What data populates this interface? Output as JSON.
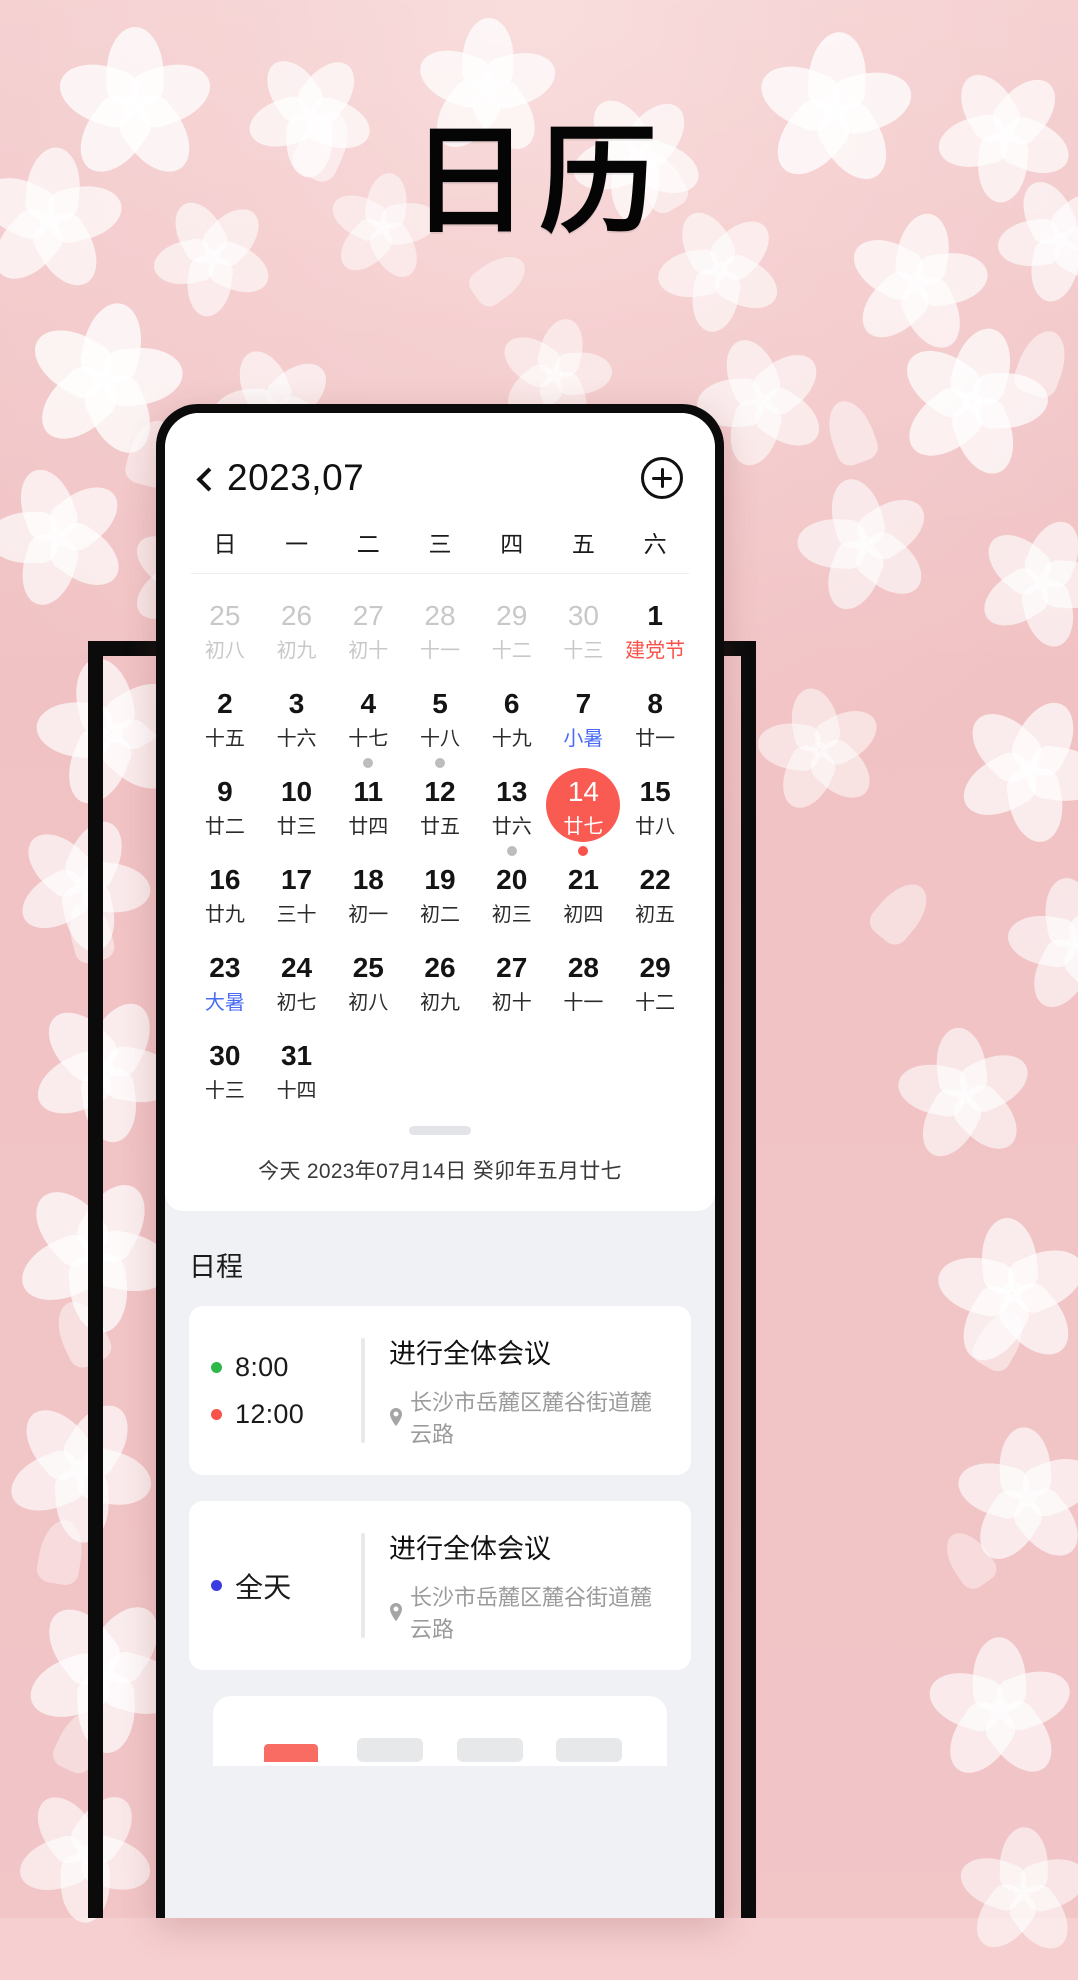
{
  "page": {
    "title": "日历",
    "background_color": "#f3c8ca",
    "accent_color": "#F8534A"
  },
  "calendar": {
    "back_icon": "chevron-left-icon",
    "year_month": "2023,07",
    "add_icon": "plus-circle-icon",
    "weekdays": [
      "日",
      "一",
      "二",
      "三",
      "四",
      "五",
      "六"
    ],
    "today_line": "今天 2023年07月14日  癸卯年五月廿七",
    "weeks": [
      [
        {
          "num": "25",
          "lunar": "初八",
          "out": true
        },
        {
          "num": "26",
          "lunar": "初九",
          "out": true
        },
        {
          "num": "27",
          "lunar": "初十",
          "out": true
        },
        {
          "num": "28",
          "lunar": "十一",
          "out": true
        },
        {
          "num": "29",
          "lunar": "十二",
          "out": true
        },
        {
          "num": "30",
          "lunar": "十三",
          "out": true
        },
        {
          "num": "1",
          "lunar": "建党节",
          "lunar_color": "red"
        }
      ],
      [
        {
          "num": "2",
          "lunar": "十五"
        },
        {
          "num": "3",
          "lunar": "十六"
        },
        {
          "num": "4",
          "lunar": "十七"
        },
        {
          "num": "5",
          "lunar": "十八"
        },
        {
          "num": "6",
          "lunar": "十九"
        },
        {
          "num": "7",
          "lunar": "小暑",
          "lunar_color": "blue"
        },
        {
          "num": "8",
          "lunar": "廿一"
        }
      ],
      [
        {
          "num": "9",
          "lunar": "廿二"
        },
        {
          "num": "10",
          "lunar": "廿三"
        },
        {
          "num": "11",
          "lunar": "廿四",
          "dot": "gray"
        },
        {
          "num": "12",
          "lunar": "廿五",
          "dot": "gray"
        },
        {
          "num": "13",
          "lunar": "廿六"
        },
        {
          "num": "14",
          "lunar": "廿七",
          "selected": true
        },
        {
          "num": "15",
          "lunar": "廿八"
        }
      ],
      [
        {
          "num": "16",
          "lunar": "廿九"
        },
        {
          "num": "17",
          "lunar": "三十"
        },
        {
          "num": "18",
          "lunar": "初一"
        },
        {
          "num": "19",
          "lunar": "初二"
        },
        {
          "num": "20",
          "lunar": "初三",
          "dot": "gray"
        },
        {
          "num": "21",
          "lunar": "初四",
          "dot": "red"
        },
        {
          "num": "22",
          "lunar": "初五"
        }
      ],
      [
        {
          "num": "23",
          "lunar": "大暑",
          "lunar_color": "blue"
        },
        {
          "num": "24",
          "lunar": "初七"
        },
        {
          "num": "25",
          "lunar": "初八"
        },
        {
          "num": "26",
          "lunar": "初九"
        },
        {
          "num": "27",
          "lunar": "初十"
        },
        {
          "num": "28",
          "lunar": "十一"
        },
        {
          "num": "29",
          "lunar": "十二"
        }
      ],
      [
        {
          "num": "30",
          "lunar": "十三"
        },
        {
          "num": "31",
          "lunar": "十四"
        },
        {
          "num": "",
          "lunar": ""
        },
        {
          "num": "",
          "lunar": ""
        },
        {
          "num": "",
          "lunar": ""
        },
        {
          "num": "",
          "lunar": ""
        },
        {
          "num": "",
          "lunar": ""
        }
      ]
    ]
  },
  "schedule": {
    "title": "日程",
    "events": [
      {
        "start_time": "8:00",
        "end_time": "12:00",
        "start_dot_color": "#2fb84a",
        "end_dot_color": "#F8534A",
        "title": "进行全体会议",
        "location": "长沙市岳麓区麓谷街道麓云路",
        "location_icon": "map-pin-icon"
      },
      {
        "all_day_label": "全天",
        "all_day_dot_color": "#3b3be0",
        "title": "进行全体会议",
        "location": "长沙市岳麓区麓谷街道麓云路",
        "location_icon": "map-pin-icon"
      }
    ]
  }
}
